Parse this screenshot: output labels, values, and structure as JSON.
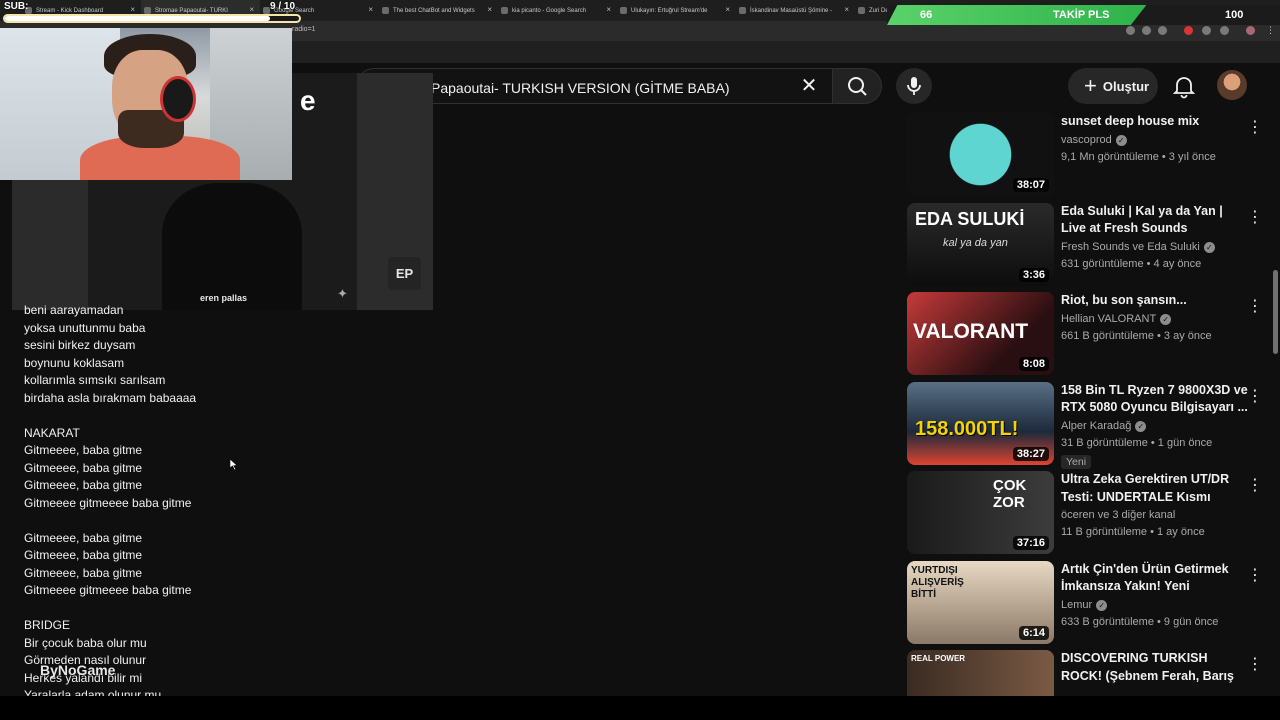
{
  "browser": {
    "tabs": [
      {
        "title": "Stream - Kick Dashboard"
      },
      {
        "title": "Stromae Papaoutai- TURKI"
      },
      {
        "title": "Google Search"
      },
      {
        "title": "The best ChatBot and Widgets"
      },
      {
        "title": "kia picanto - Google Search"
      },
      {
        "title": "Ulukayın: Ertuğrul Stream'de"
      },
      {
        "title": "İskandinav Masaüstü Şömine -"
      },
      {
        "title": "Zuri Design"
      }
    ],
    "url_fragment": "radio=1"
  },
  "stream_overlay": {
    "sub_label": "SUB:",
    "sub_count": "9 / 10",
    "sub_progress": 0.9,
    "follow_current": "66",
    "follow_label": "TAKİP PLS",
    "follow_goal": "100",
    "follow_progress": 0.66,
    "watermark": "ByNoGame"
  },
  "masthead": {
    "search_value": "Papaoutai- TURKISH VERSION (GİTME BABA)",
    "create_label": "Oluştur"
  },
  "player": {
    "caption": "eren pallas",
    "badge": "EP",
    "logo_fragment": "e"
  },
  "lyrics": [
    "beni aarayamadan",
    "yoksa unuttunmu baba",
    "sesini birkez duysam",
    "boynunu koklasam",
    "kollarımla sımsıkı sarılsam",
    "birdaha asla bırakmam babaaaa",
    "",
    "NAKARAT",
    "Gitmeeee, baba gitme",
    "Gitmeeee, baba gitme",
    "Gitmeeee, baba gitme",
    "Gitmeeee gitmeeee baba gitme",
    "",
    "Gitmeeee, baba gitme",
    "Gitmeeee, baba gitme",
    "Gitmeeee, baba gitme",
    "Gitmeeee gitmeeee baba gitme",
    "",
    "BRIDGE",
    "Bir çocuk baba olur mu",
    "Görmeden nasıl olunur",
    "Herkes yalandı bilir mi",
    "Yaralarla adam olunur mu"
  ],
  "recommendations": [
    {
      "title": "sunset deep house mix",
      "channel": "vascoprod",
      "verified": true,
      "stats": "9,1 Mn görüntüleme • 3 yıl önce",
      "duration": "38:07",
      "badge": ""
    },
    {
      "title": "Eda Suluki | Kal ya da Yan | Live at Fresh Sounds",
      "channel": "Fresh Sounds ve Eda Suluki",
      "verified": true,
      "stats": "631 görüntüleme • 4 ay önce",
      "duration": "3:36",
      "badge": ""
    },
    {
      "title": "Riot, bu son şansın...",
      "channel": "Hellian VALORANT",
      "verified": true,
      "stats": "661 B görüntüleme • 3 ay önce",
      "duration": "8:08",
      "badge": ""
    },
    {
      "title": "158 Bin TL Ryzen 7 9800X3D ve RTX 5080 Oyuncu Bilgisayarı ...",
      "channel": "Alper Karadağ",
      "verified": true,
      "stats": "31 B görüntüleme • 1 gün önce",
      "duration": "38:27",
      "badge": "Yeni"
    },
    {
      "title": "Ultra Zeka Gerektiren UT/DR Testi: UNDERTALE Kısmı",
      "channel": "öceren ve 3 diğer kanal",
      "verified": false,
      "stats": "11 B görüntüleme • 1 ay önce",
      "duration": "37:16",
      "badge": ""
    },
    {
      "title": "Artık Çin'den Ürün Getirmek İmkansıza Yakın! Yeni Gümrük...",
      "channel": "Lemur",
      "verified": true,
      "stats": "633 B görüntüleme • 9 gün önce",
      "duration": "6:14",
      "badge": ""
    },
    {
      "title": "DISCOVERING TURKISH ROCK! (Şebnem Ferah, Barış Manço, ...",
      "channel": "",
      "verified": false,
      "stats": "",
      "duration": "",
      "badge": ""
    }
  ],
  "thumbnail_text": [
    {
      "text": "EDA SULUKİ",
      "sub": "kal ya da yan"
    },
    {
      "text": "VALORANT"
    },
    {
      "text": "158.000TL!"
    },
    {
      "text": "ÇOK ZOR"
    },
    {
      "text": "YURTDIŞI ALIŞVERİŞ BİTTİ"
    },
    {
      "text": "REAL POWER"
    }
  ],
  "colors": {
    "background": "#0f0f0f",
    "follow_green": "#3cc454",
    "text_secondary": "#aaaaaa"
  }
}
